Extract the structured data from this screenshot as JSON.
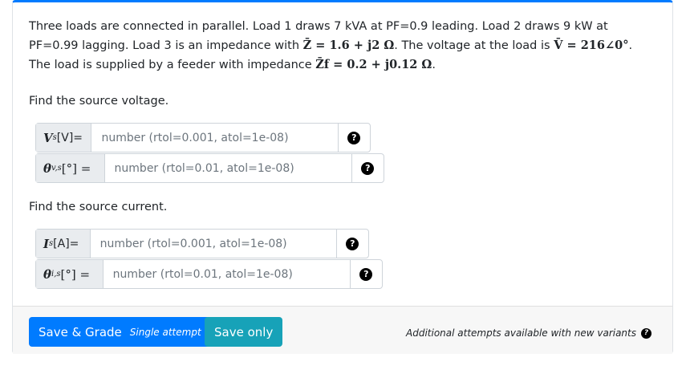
{
  "problem": {
    "text_part1": "Three loads are connected in parallel. Load 1 draws 7 kVA at PF=0.9 leading. Load 2 draws 9 kW at PF=0.99 lagging. Load 3 is an impedance with ",
    "math_z": "Z̄ = 1.6 + j2 Ω",
    "text_part2": ". The voltage at the load is ",
    "math_v": "V̄ = 216∠0°",
    "text_part3": ". The load is supplied by a feeder with impedance ",
    "math_zf": "Z̄f = 0.2 + j0.12 Ω",
    "text_part4": "."
  },
  "questions": [
    {
      "prompt": "Find the source voltage.",
      "inputs": [
        {
          "var": "V",
          "sub": "s",
          "unit": "[V]=",
          "placeholder": "number (rtol=0.001, atol=1e-08)"
        },
        {
          "var": "θ",
          "sub": "v,s",
          "unit": " [°] =",
          "placeholder": "number (rtol=0.01, atol=1e-08)"
        }
      ]
    },
    {
      "prompt": "Find the source current.",
      "inputs": [
        {
          "var": "I",
          "sub": "s",
          "unit": "[A]=",
          "placeholder": "number (rtol=0.001, atol=1e-08)"
        },
        {
          "var": "θ",
          "sub": "i,s",
          "unit": " [°] =",
          "placeholder": "number (rtol=0.01, atol=1e-08)"
        }
      ]
    }
  ],
  "footer": {
    "save_grade_label": "Save & Grade",
    "single_attempt_label": "Single attempt",
    "save_only_label": "Save only",
    "attempts_note": "Additional attempts available with new variants"
  },
  "icons": {
    "help": "question-circle-icon"
  },
  "colors": {
    "primary": "#007bff",
    "info": "#17a2b8",
    "accent_top": "#007bff"
  }
}
